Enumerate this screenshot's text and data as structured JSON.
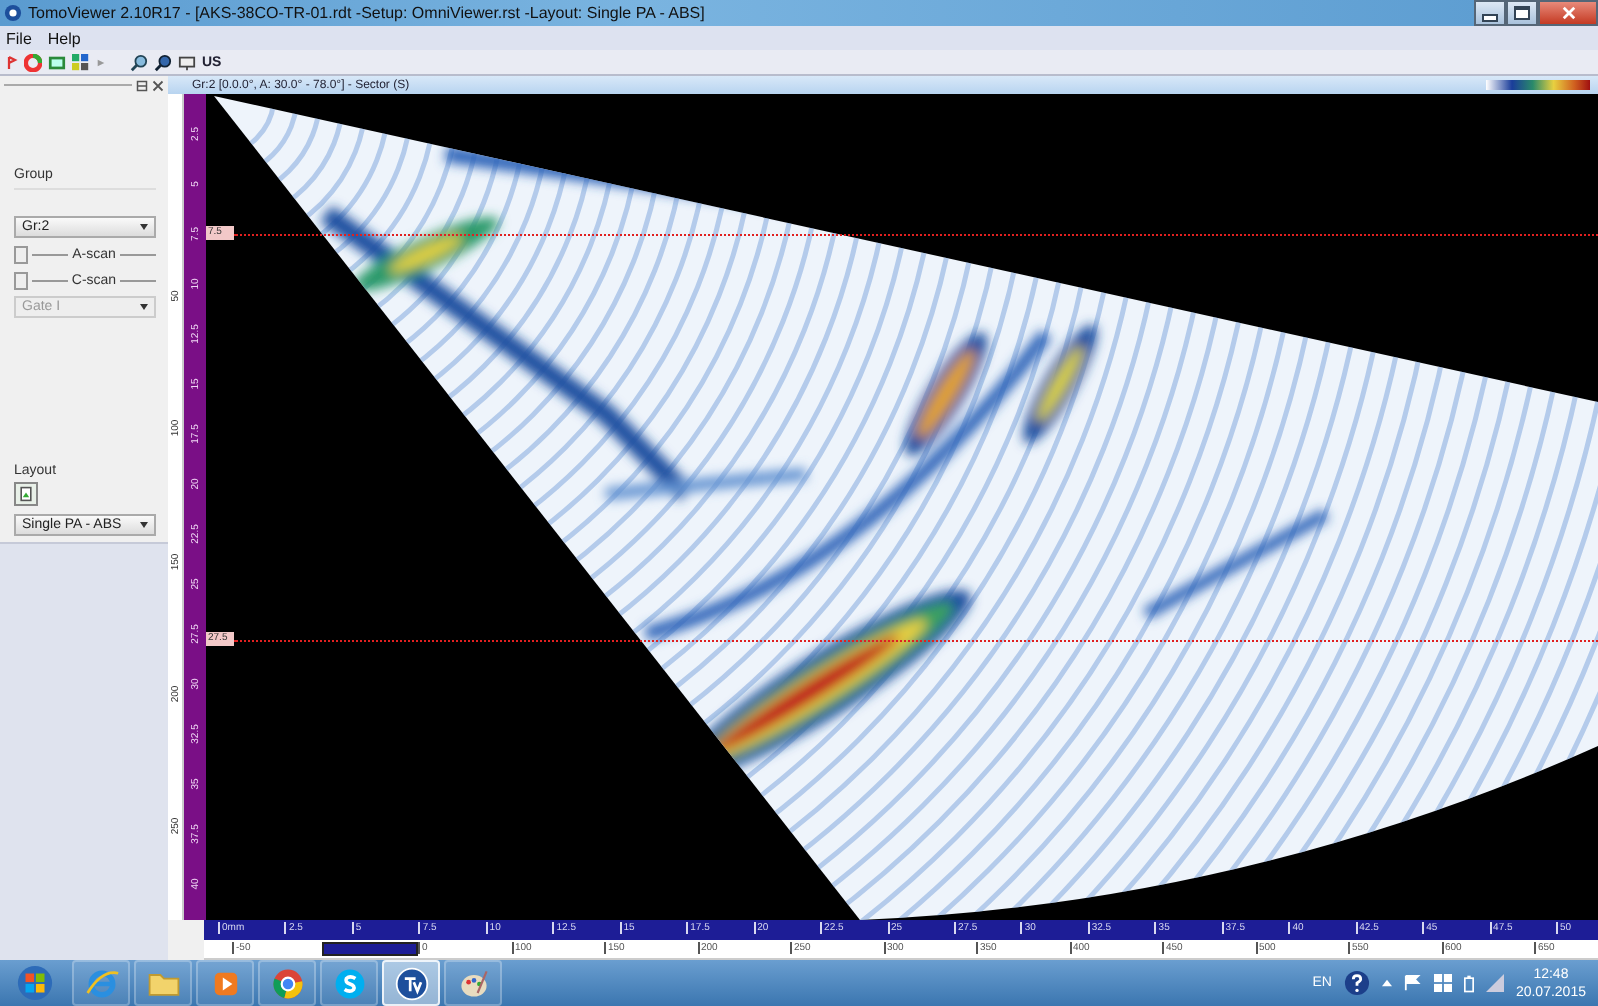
{
  "window": {
    "title": "TomoViewer 2.10R17 - [AKS-38CO-TR-01.rdt -Setup: OmniViewer.rst -Layout: Single PA - ABS]"
  },
  "menu": [
    {
      "label": "File"
    },
    {
      "label": "Help"
    }
  ],
  "toolbar": {
    "mode_label": "US"
  },
  "left_panel": {
    "group_label": "Group",
    "group_select": "Gr:2",
    "toggles": [
      {
        "label": "A-scan"
      },
      {
        "label": "C-scan"
      }
    ],
    "gate_select": {
      "value": "Gate I",
      "disabled": true
    },
    "layout_label": "Layout",
    "layout_select": "Single PA - ABS"
  },
  "view": {
    "header": "Gr:2 [0.0.0°, A: 30.0° - 78.0°] - Sector (S)",
    "depth_ruler_labels": [
      "50",
      "100",
      "150",
      "200",
      "250"
    ],
    "vertical_ruler_labels": [
      "2.5",
      "5",
      "7.5",
      "10",
      "12.5",
      "15",
      "17.5",
      "20",
      "22.5",
      "25",
      "27.5",
      "30",
      "32.5",
      "35",
      "37.5",
      "40"
    ],
    "cursors": [
      {
        "label": "7.5"
      },
      {
        "label": "27.5"
      }
    ],
    "horizontal_ruler_labels": [
      "0mm",
      "2.5",
      "5",
      "7.5",
      "10",
      "12.5",
      "15",
      "17.5",
      "20",
      "22.5",
      "25",
      "27.5",
      "30",
      "32.5",
      "35",
      "37.5",
      "40",
      "42.5",
      "45",
      "47.5",
      "50"
    ],
    "index_ruler_labels": [
      "-50",
      "0",
      "100",
      "150",
      "200",
      "250",
      "300",
      "350",
      "400",
      "450",
      "500",
      "550",
      "600",
      "650"
    ]
  },
  "taskbar": {
    "apps": [
      {
        "kind": "browser",
        "selected": false
      },
      {
        "kind": "folder",
        "selected": false
      },
      {
        "kind": "media",
        "selected": false
      },
      {
        "kind": "chrome",
        "selected": false
      },
      {
        "kind": "skype",
        "selected": false
      },
      {
        "kind": "tomoviewer",
        "selected": true
      },
      {
        "kind": "paint",
        "selected": false
      }
    ],
    "tray": {
      "language": "EN",
      "time": "12:48",
      "date": "20.07.2015"
    }
  }
}
